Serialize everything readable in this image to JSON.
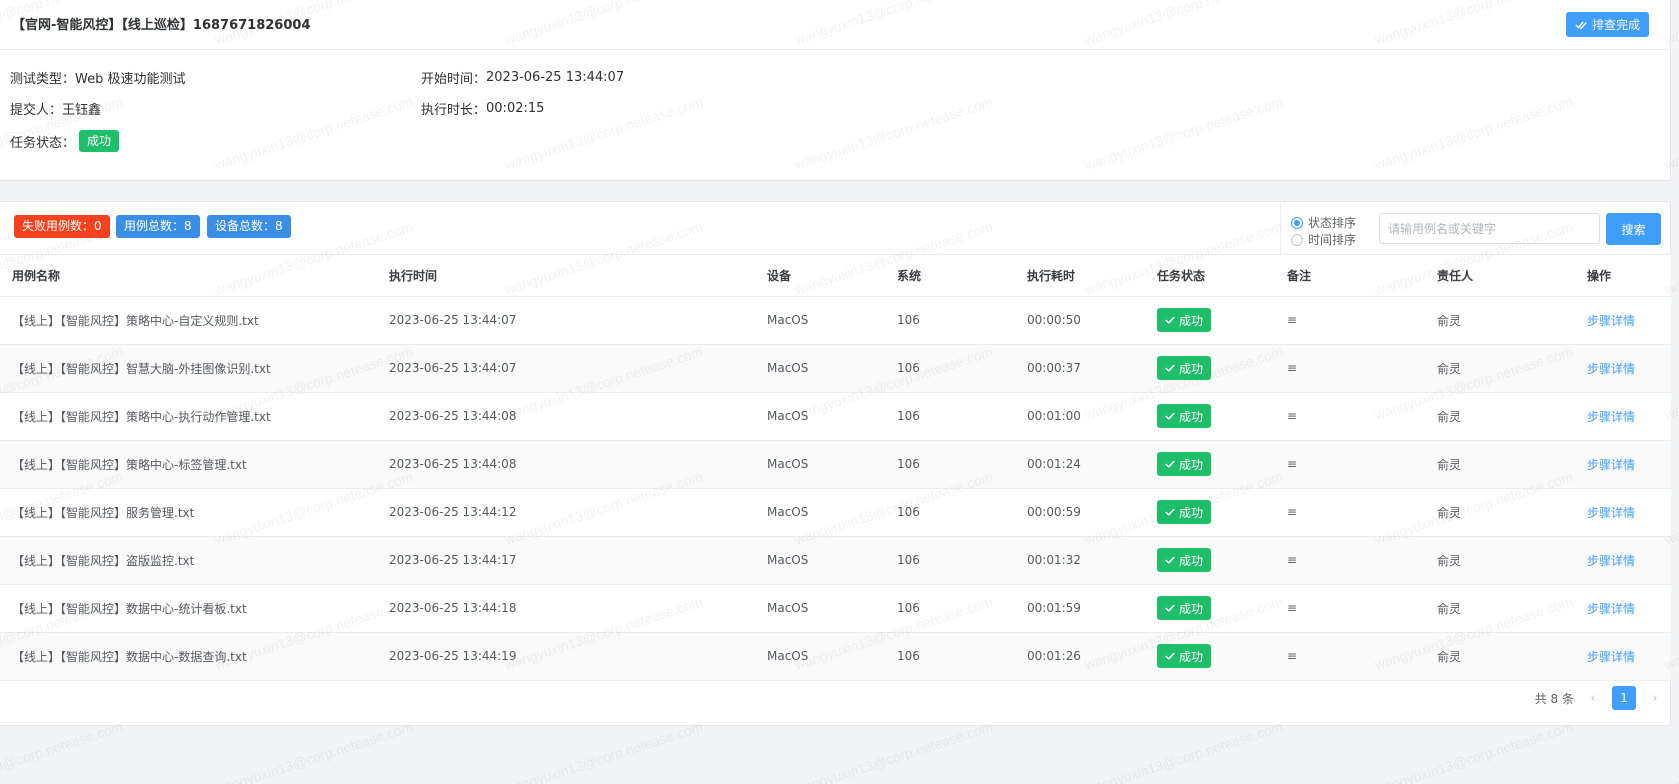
{
  "header": {
    "title": "【官网-智能风控】【线上巡检】1687671826004",
    "done_label": "排查完成"
  },
  "info": {
    "test_type_label": "测试类型：",
    "test_type_value": "Web 极速功能测试",
    "start_time_label": "开始时间：",
    "start_time_value": "2023-06-25 13:44:07",
    "submitter_label": "提交人：",
    "submitter_value": "王钰鑫",
    "duration_label": "执行时长：",
    "duration_value": "00:02:15",
    "status_label": "任务状态：",
    "status_value": "成功"
  },
  "toolbar": {
    "failed_cases": "失败用例数：0",
    "total_cases": "用例总数：8",
    "total_devices": "设备总数：8",
    "sort_status": "状态排序",
    "sort_time": "时间排序",
    "search_placeholder": "请输用例名或关键字",
    "search_label": "搜索"
  },
  "table": {
    "columns": [
      "用例名称",
      "执行时间",
      "设备",
      "系统",
      "执行耗时",
      "任务状态",
      "备注",
      "责任人",
      "操作"
    ],
    "rows": [
      {
        "name": "【线上】【智能风控】策略中心-自定义规则.txt",
        "time": "2023-06-25 13:44:07",
        "device": "MacOS",
        "system": "106",
        "elapsed": "00:00:50",
        "status": "成功",
        "note": "≡",
        "owner": "俞灵",
        "action": "步骤详情"
      },
      {
        "name": "【线上】【智能风控】智慧大脑-外挂图像识别.txt",
        "time": "2023-06-25 13:44:07",
        "device": "MacOS",
        "system": "106",
        "elapsed": "00:00:37",
        "status": "成功",
        "note": "≡",
        "owner": "俞灵",
        "action": "步骤详情"
      },
      {
        "name": "【线上】【智能风控】策略中心-执行动作管理.txt",
        "time": "2023-06-25 13:44:08",
        "device": "MacOS",
        "system": "106",
        "elapsed": "00:01:00",
        "status": "成功",
        "note": "≡",
        "owner": "俞灵",
        "action": "步骤详情"
      },
      {
        "name": "【线上】【智能风控】策略中心-标签管理.txt",
        "time": "2023-06-25 13:44:08",
        "device": "MacOS",
        "system": "106",
        "elapsed": "00:01:24",
        "status": "成功",
        "note": "≡",
        "owner": "俞灵",
        "action": "步骤详情"
      },
      {
        "name": "【线上】【智能风控】服务管理.txt",
        "time": "2023-06-25 13:44:12",
        "device": "MacOS",
        "system": "106",
        "elapsed": "00:00:59",
        "status": "成功",
        "note": "≡",
        "owner": "俞灵",
        "action": "步骤详情"
      },
      {
        "name": "【线上】【智能风控】盗版监控.txt",
        "time": "2023-06-25 13:44:17",
        "device": "MacOS",
        "system": "106",
        "elapsed": "00:01:32",
        "status": "成功",
        "note": "≡",
        "owner": "俞灵",
        "action": "步骤详情"
      },
      {
        "name": "【线上】【智能风控】数据中心-统计看板.txt",
        "time": "2023-06-25 13:44:18",
        "device": "MacOS",
        "system": "106",
        "elapsed": "00:01:59",
        "status": "成功",
        "note": "≡",
        "owner": "俞灵",
        "action": "步骤详情"
      },
      {
        "name": "【线上】【智能风控】数据中心-数据查询.txt",
        "time": "2023-06-25 13:44:19",
        "device": "MacOS",
        "system": "106",
        "elapsed": "00:01:26",
        "status": "成功",
        "note": "≡",
        "owner": "俞灵",
        "action": "步骤详情"
      }
    ]
  },
  "pagination": {
    "total_text": "共 8 条",
    "current_page": "1",
    "prev_icon": "‹",
    "next_icon": "›"
  },
  "watermark": "wangyuxin13@corp.netease.com",
  "colors": {
    "primary": "#409eff",
    "success": "#1fbe6a",
    "danger": "#f5421e"
  }
}
